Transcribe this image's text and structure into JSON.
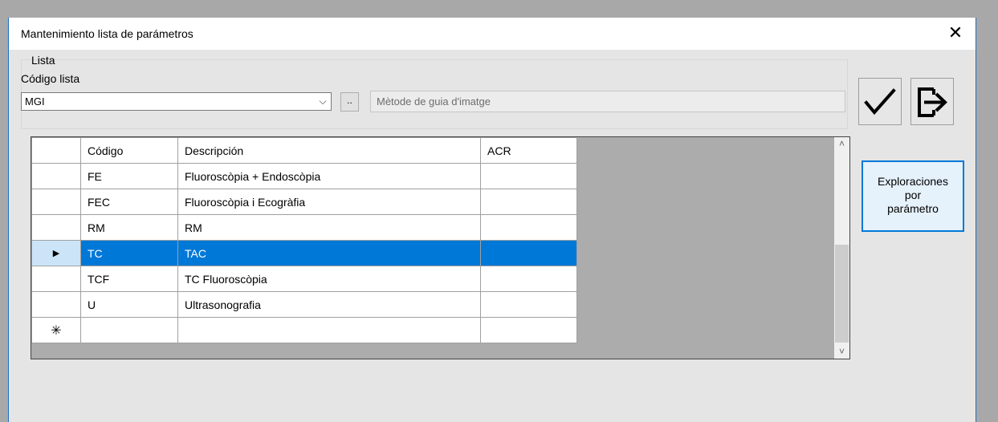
{
  "window": {
    "title": "Mantenimiento lista de parámetros",
    "close_glyph": "✕"
  },
  "lista": {
    "group_label": "Lista",
    "codigo_label": "Código lista",
    "combo_value": "MGI",
    "combo_arrow": "⌵",
    "browse_label": "..",
    "description_placeholder": "Mètode de guia d'imatge"
  },
  "toolbar": {
    "accept_icon": "check-icon",
    "exit_icon": "exit-icon"
  },
  "grid": {
    "columns": [
      "Código",
      "Descripción",
      "ACR"
    ],
    "rows": [
      {
        "marker": "",
        "codigo": "FE",
        "descripcion": "Fluoroscòpia + Endoscòpia",
        "acr": ""
      },
      {
        "marker": "",
        "codigo": "FEC",
        "descripcion": "Fluoroscòpia i Ecogràfia",
        "acr": ""
      },
      {
        "marker": "",
        "codigo": "RM",
        "descripcion": "RM",
        "acr": ""
      },
      {
        "marker": "▶",
        "codigo": "TC",
        "descripcion": "TAC",
        "acr": "",
        "selected": true
      },
      {
        "marker": "",
        "codigo": "TCF",
        "descripcion": "TC Fluoroscòpia",
        "acr": ""
      },
      {
        "marker": "",
        "codigo": "U",
        "descripcion": "Ultrasonografia",
        "acr": ""
      },
      {
        "marker": "✳",
        "codigo": "",
        "descripcion": "",
        "acr": ""
      }
    ],
    "scroll_up": "˄",
    "scroll_down": "˅"
  },
  "side_button": {
    "line1": "Exploraciones",
    "line2": "por",
    "line3": "parámetro"
  },
  "colors": {
    "selection": "#0078d7",
    "accent_border": "#1a6fc4"
  }
}
